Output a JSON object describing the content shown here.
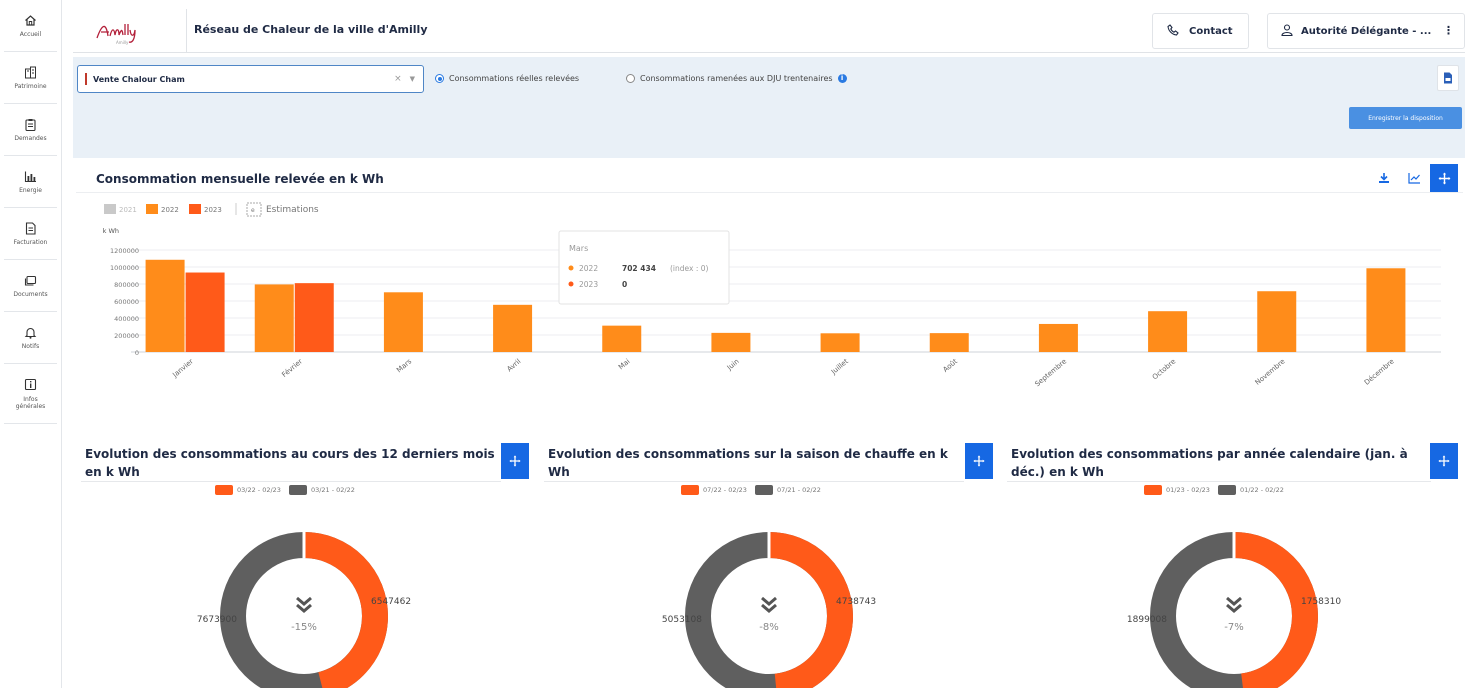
{
  "colors": {
    "accent_blue": "#1668e3",
    "orange": "#ff8c1a",
    "dark_orange": "#ff5a19",
    "grey": "#5f5f5f",
    "light_grey": "#c9c9c9"
  },
  "sidebar": {
    "items": [
      {
        "label": "Accueil",
        "icon": "home-icon"
      },
      {
        "label": "Patrimoine",
        "icon": "building-icon"
      },
      {
        "label": "Demandes",
        "icon": "clipboard-icon"
      },
      {
        "label": "Energie",
        "icon": "chart-icon"
      },
      {
        "label": "Facturation",
        "icon": "invoice-icon"
      },
      {
        "label": "Documents",
        "icon": "documents-icon"
      },
      {
        "label": "Notifs",
        "icon": "bell-icon"
      },
      {
        "label": "Infos générales",
        "icon": "info-icon"
      }
    ]
  },
  "header": {
    "logo_text": "Amilly",
    "title": "Réseau de Chaleur de la ville d'Amilly",
    "contact_label": "Contact",
    "user_label": "Autorité Délégante - ...",
    "more_label": "⋮"
  },
  "filters": {
    "site_value": "Vente Chalour Cham",
    "clear_label": "×",
    "radio_real_label": "Consommations réelles relevées",
    "radio_dju_label": "Consommations ramenées aux DJU trentenaires",
    "info_label": "i",
    "save_layout_label": "Enregistrer la disposition"
  },
  "main_chart": {
    "title": "Consommation mensuelle relevée en k Wh",
    "legend": [
      {
        "label": "2021",
        "color": "#c9c9c9"
      },
      {
        "label": "2022",
        "color": "#ff8c1a"
      },
      {
        "label": "2023",
        "color": "#ff5a19"
      }
    ],
    "estimations_label": "Estimations",
    "unit_label": "k Wh",
    "tooltip": {
      "title": "Mars",
      "rows": [
        {
          "series": "2022",
          "value": "702 434",
          "extra": "(index : 0)"
        },
        {
          "series": "2023",
          "value": "0",
          "extra": ""
        }
      ]
    }
  },
  "chart_data": {
    "type": "bar",
    "ylabel": "k Wh",
    "ylim": [
      0,
      1200000
    ],
    "yticks": [
      0,
      200000,
      400000,
      600000,
      800000,
      1000000,
      1200000
    ],
    "ytick_labels": [
      "0",
      "200000",
      "400000",
      "600000",
      "800000",
      "1000000",
      "1200000"
    ],
    "categories": [
      "Janvier",
      "Février",
      "Mars",
      "Avril",
      "Mai",
      "Juin",
      "Juillet",
      "Août",
      "Septembre",
      "Octobre",
      "Novembre",
      "Décembre"
    ],
    "series": [
      {
        "name": "2022",
        "color": "#ff8c1a",
        "values": [
          1085000,
          795000,
          702434,
          555000,
          310000,
          225000,
          220000,
          222000,
          330000,
          480000,
          715000,
          985000
        ]
      },
      {
        "name": "2023",
        "color": "#ff5a19",
        "values": [
          935000,
          810000,
          0,
          null,
          null,
          null,
          null,
          null,
          null,
          null,
          null,
          null
        ]
      }
    ],
    "grid": true,
    "legend_position": "top-left"
  },
  "donuts": [
    {
      "title": "Evolution des consommations au cours des 12 derniers mois en k Wh",
      "legend_a": "03/22 - 02/23",
      "legend_b": "03/21 - 02/22",
      "value_a": "6547462",
      "value_b": "7673900",
      "pct": "-15%",
      "a_share": 0.46
    },
    {
      "title": "Evolution des consommations sur la saison de chauffe en k Wh",
      "legend_a": "07/22 - 02/23",
      "legend_b": "07/21 - 02/22",
      "value_a": "4738743",
      "value_b": "5053108",
      "pct": "-8%",
      "a_share": 0.484
    },
    {
      "title": "Evolution des consommations par année calendaire (jan. à déc.) en k Wh",
      "legend_a": "01/23 - 02/23",
      "legend_b": "01/22 - 02/22",
      "value_a": "1758310",
      "value_b": "1899008",
      "pct": "-7%",
      "a_share": 0.48
    }
  ]
}
